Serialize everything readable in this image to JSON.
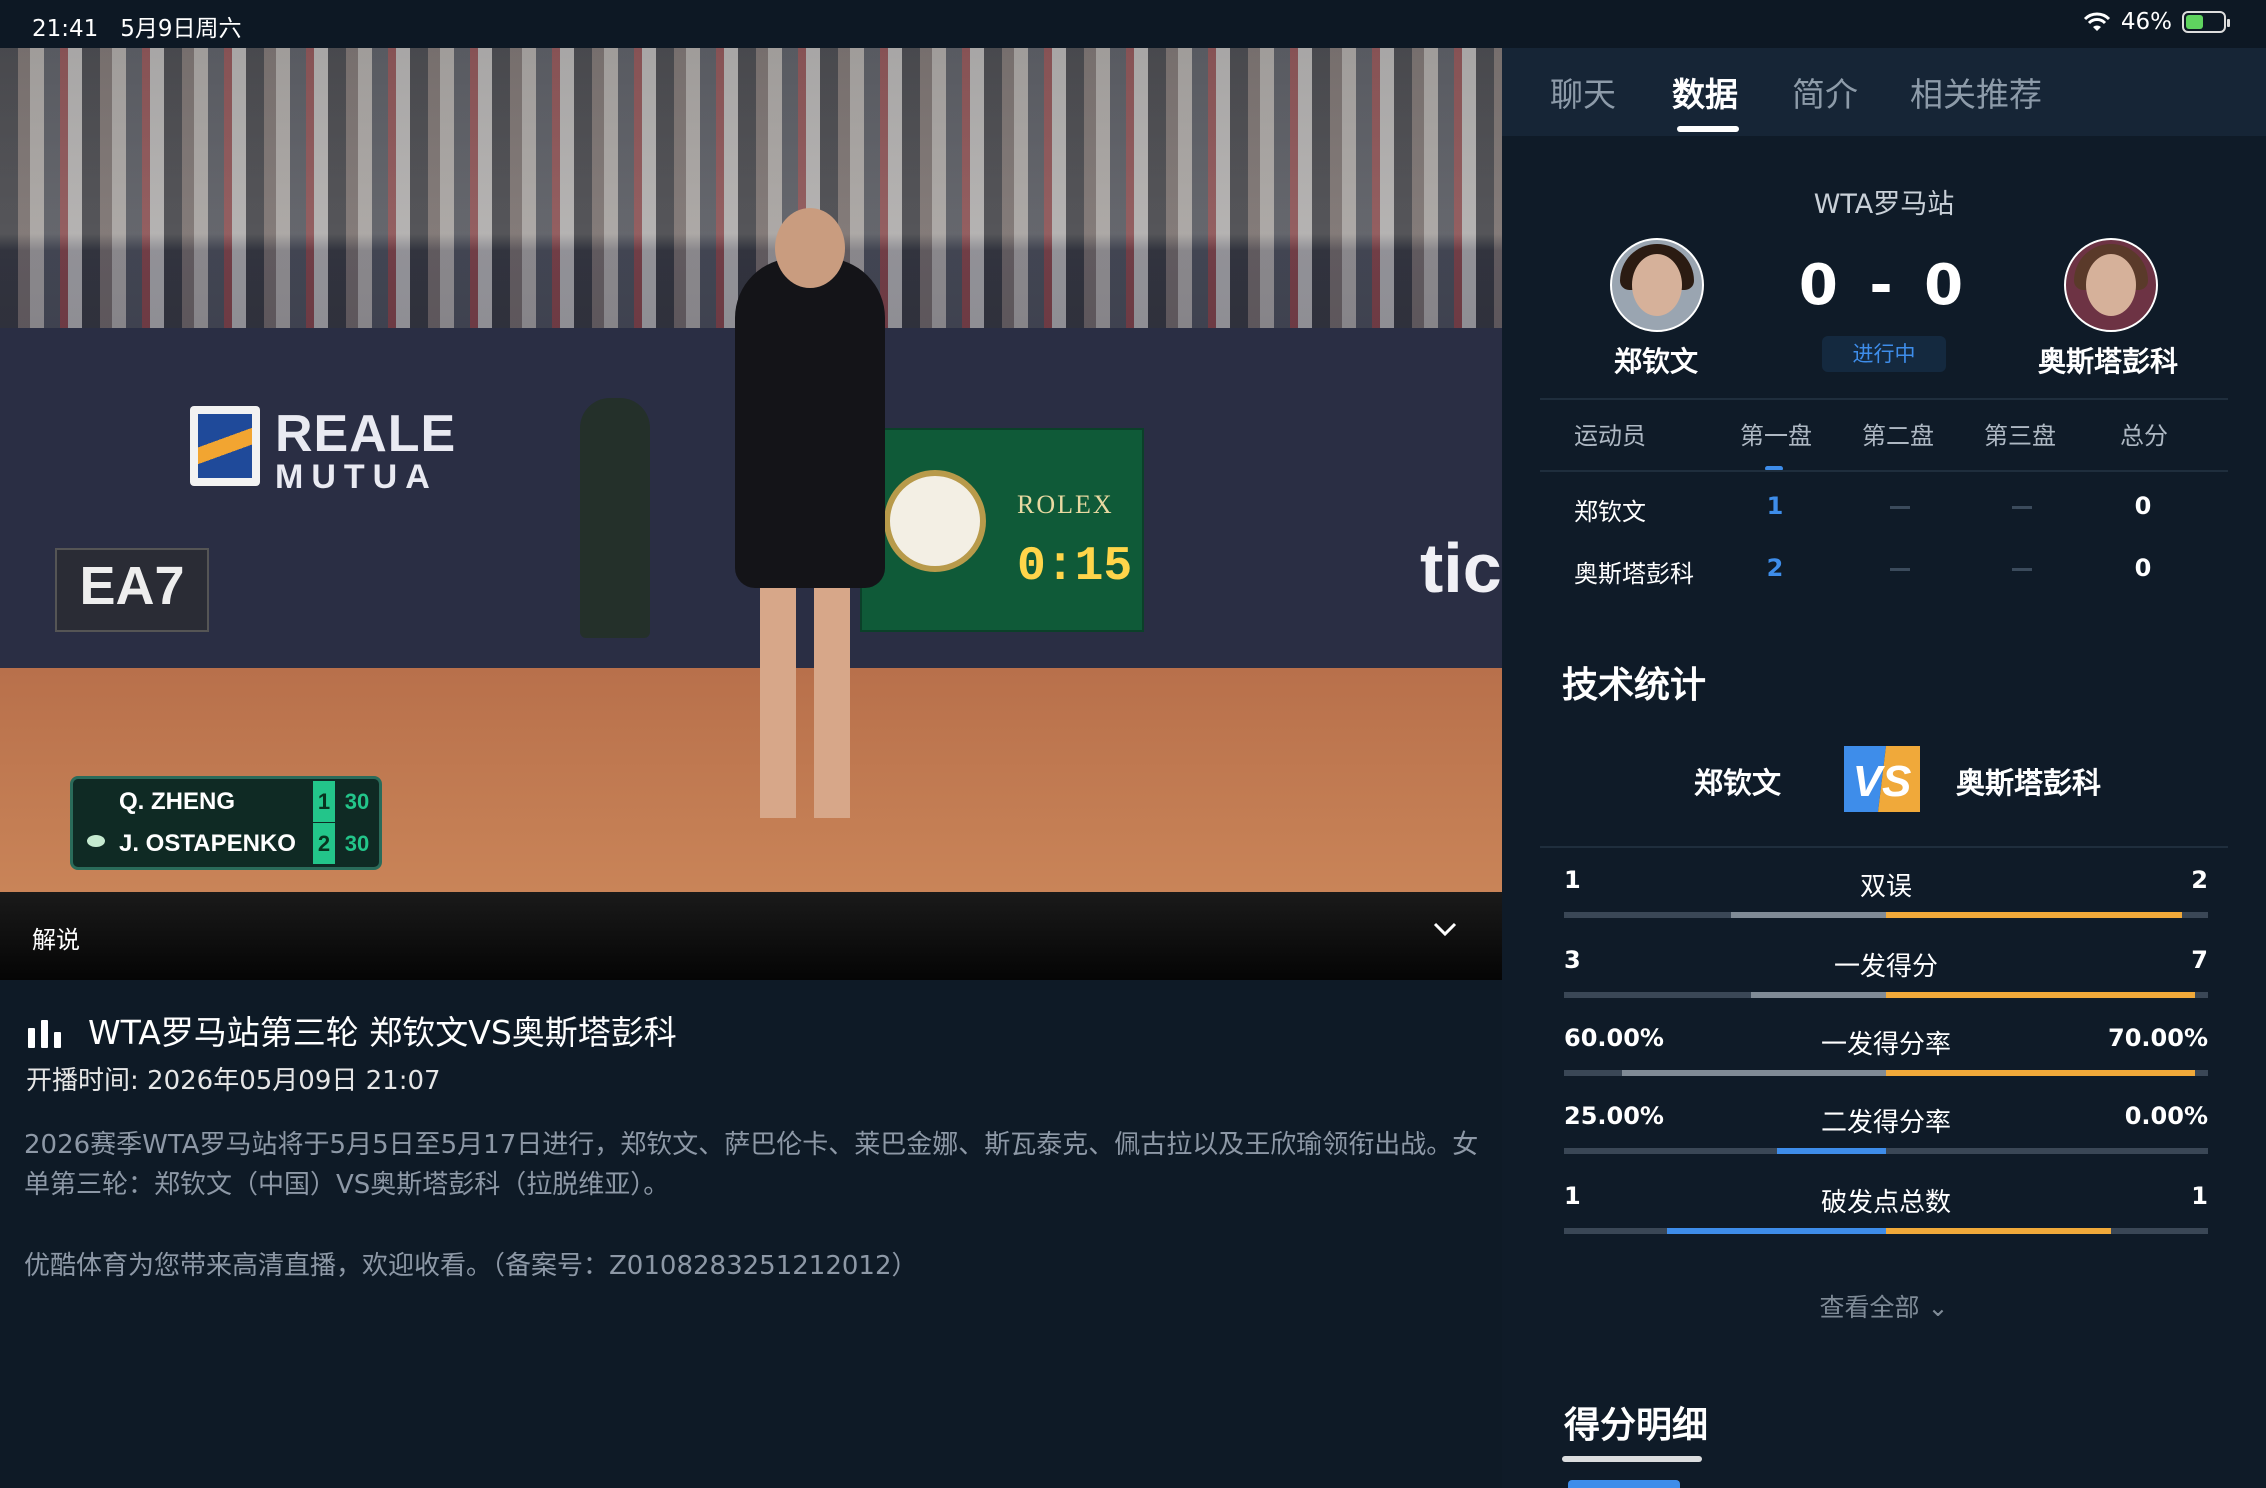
{
  "status_bar": {
    "time": "21:41",
    "date": "5月9日周六",
    "battery": "46%",
    "battery_level": 0.46
  },
  "video": {
    "scorebug": {
      "p1": {
        "name": "Q. ZHENG",
        "set": "1",
        "points": "30"
      },
      "p2": {
        "name": "J. OSTAPENKO",
        "set": "2",
        "points": "30"
      }
    },
    "board": {
      "brand": "ROLEX",
      "clock": "0:15"
    },
    "banners": {
      "reale": "REALE",
      "mutua": "MUTUA",
      "ea7": "EA7",
      "ticket": "tick"
    }
  },
  "commentary": {
    "label": "解说"
  },
  "info": {
    "title": "WTA罗马站第三轮 郑钦文VS奥斯塔彭科",
    "time": "开播时间: 2026年05月09日 21:07",
    "description": "2026赛季WTA罗马站将于5月5日至5月17日进行，郑钦文、萨巴伦卡、莱巴金娜、斯瓦泰克、佩古拉以及王欣瑜领衔出战。女单第三轮：郑钦文（中国）VS奥斯塔彭科（拉脱维亚）。",
    "note": "优酷体育为您带来高清直播，欢迎收看。（备案号：Z0108283251212012）"
  },
  "tabs": [
    {
      "label": "聊天"
    },
    {
      "label": "数据"
    },
    {
      "label": "简介"
    },
    {
      "label": "相关推荐"
    }
  ],
  "match": {
    "league": "WTA罗马站",
    "player1": "郑钦文",
    "player2": "奥斯塔彭科",
    "score": "0 - 0",
    "status": "进行中"
  },
  "table": {
    "headers": [
      "运动员",
      "第一盘",
      "第二盘",
      "第三盘",
      "总分"
    ],
    "rows": [
      {
        "name": "郑钦文",
        "set1": "1",
        "total": "0"
      },
      {
        "name": "奥斯塔彭科",
        "set1": "2",
        "total": "0"
      }
    ]
  },
  "tech": {
    "title": "技术统计",
    "left_name": "郑钦文",
    "right_name": "奥斯塔彭科",
    "stats": [
      {
        "label": "双误",
        "left": "1",
        "right": "2",
        "left_frac": 0.24,
        "right_frac": 0.46
      },
      {
        "label": "一发得分",
        "left": "3",
        "right": "7",
        "left_frac": 0.21,
        "right_frac": 0.48
      },
      {
        "label": "一发得分率",
        "left": "60.00%",
        "right": "70.00%",
        "left_frac": 0.41,
        "right_frac": 0.48
      },
      {
        "label": "二发得分率",
        "left": "25.00%",
        "right": "0.00%",
        "left_frac": 0.17,
        "right_frac": 0.0
      },
      {
        "label": "破发点总数",
        "left": "1",
        "right": "1",
        "left_frac": 0.34,
        "right_frac": 0.35
      }
    ],
    "see_all": "查看全部 ⌄"
  },
  "score_detail": {
    "title": "得分明细"
  },
  "colors": {
    "accent": "#3e8dea",
    "right_bar": "#f0a93a",
    "panel_bg": "#0f1b28"
  }
}
